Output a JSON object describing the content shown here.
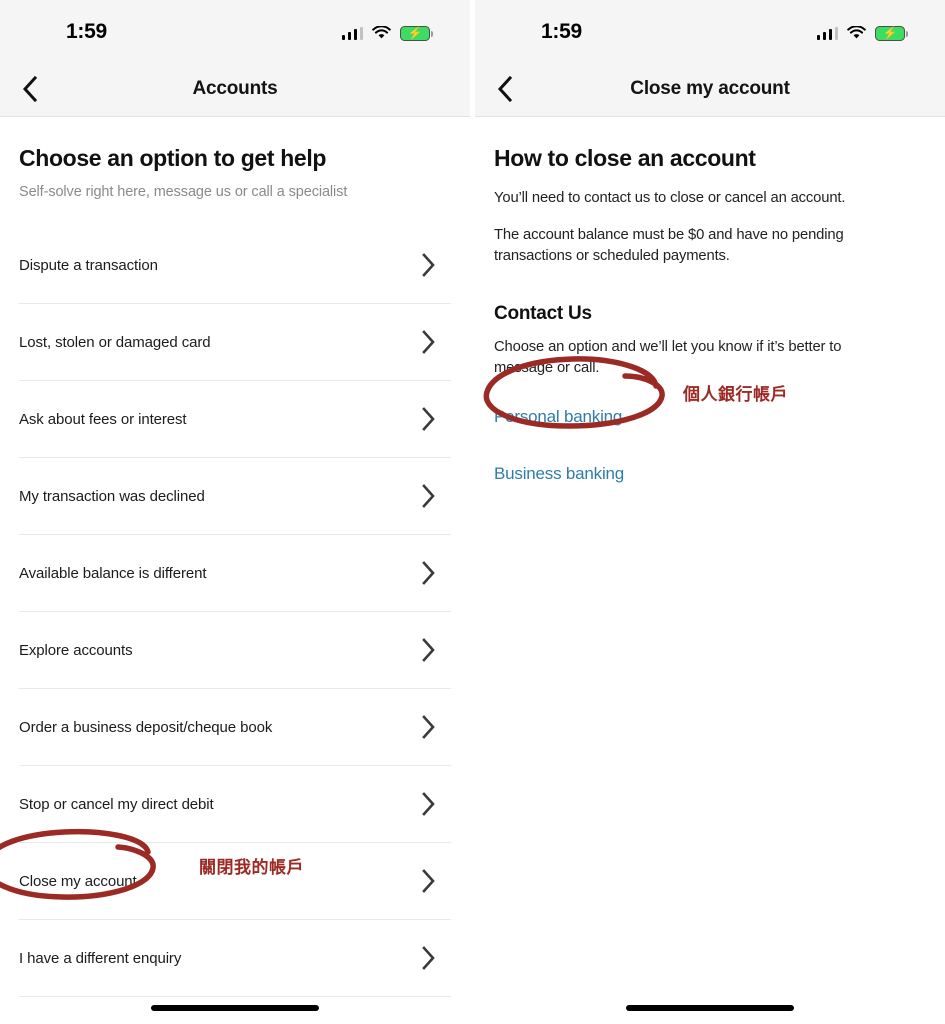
{
  "status_bar": {
    "time": "1:59",
    "signal_icon": "cellular-signal-icon",
    "wifi_icon": "wifi-icon",
    "battery_icon": "battery-charging-icon",
    "battery_color": "#3ddc63"
  },
  "left_screen": {
    "nav": {
      "back_icon": "chevron-left-icon",
      "title": "Accounts"
    },
    "heading": "Choose an option to get help",
    "subheading": "Self-solve right here, message us or call a specialist",
    "options": [
      {
        "label": "Dispute a transaction"
      },
      {
        "label": "Lost, stolen or damaged card"
      },
      {
        "label": "Ask about fees or interest"
      },
      {
        "label": "My transaction was declined"
      },
      {
        "label": "Available balance is different"
      },
      {
        "label": "Explore accounts"
      },
      {
        "label": "Order a business deposit/cheque book"
      },
      {
        "label": "Stop or cancel my direct debit"
      },
      {
        "label": "Close my account"
      },
      {
        "label": "I have a different enquiry"
      }
    ],
    "annotation": {
      "translation": "關閉我的帳戶",
      "color": "#9c2a24",
      "circled_item": "Close my account"
    }
  },
  "right_screen": {
    "nav": {
      "back_icon": "chevron-left-icon",
      "title": "Close my account"
    },
    "heading": "How to close an account",
    "paragraph_1": "You’ll need to contact us to close or cancel an account.",
    "paragraph_2": "The account balance must be $0 and have no pending transactions or scheduled payments.",
    "section_heading": "Contact Us",
    "section_paragraph": "Choose an option and we’ll let you know if it’s better to message or call.",
    "links": [
      {
        "label": "Personal banking",
        "color": "#2f7cab"
      },
      {
        "label": "Business banking",
        "color": "#2f7cab"
      }
    ],
    "annotation": {
      "translation": "個人銀行帳戶",
      "color": "#9c2a24",
      "circled_item": "Personal banking"
    }
  }
}
